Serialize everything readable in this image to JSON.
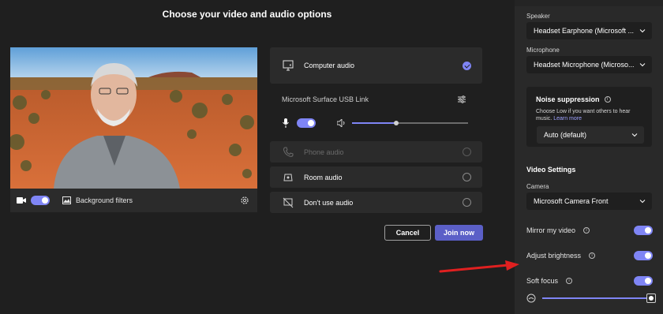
{
  "title": "Choose your video and audio options",
  "video": {
    "camera_toggle": "on",
    "background_filters_label": "Background filters"
  },
  "audio": {
    "computer_audio": "Computer audio",
    "device_name": "Microsoft Surface USB Link",
    "phone_audio": "Phone audio",
    "room_audio": "Room audio",
    "dont_use_audio": "Don't use audio",
    "mic_toggle": "on",
    "speaker_volume": 0.38
  },
  "buttons": {
    "cancel": "Cancel",
    "join": "Join now"
  },
  "panel": {
    "speaker_label": "Speaker",
    "speaker_value": "Headset Earphone (Microsoft ...",
    "microphone_label": "Microphone",
    "microphone_value": "Headset Microphone (Microso...",
    "noise_title": "Noise suppression",
    "noise_desc": "Choose Low if you want others to hear music.",
    "noise_link": "Learn more",
    "noise_value": "Auto (default)",
    "video_settings": "Video Settings",
    "camera_label": "Camera",
    "camera_value": "Microsoft Camera Front",
    "mirror_label": "Mirror my video",
    "brightness_label": "Adjust brightness",
    "soft_focus_label": "Soft focus",
    "soft_focus_level": 1.0
  },
  "colors": {
    "accent": "#7f85f5",
    "join_button": "#5b5fc7",
    "annotation_arrow": "#e02020"
  }
}
